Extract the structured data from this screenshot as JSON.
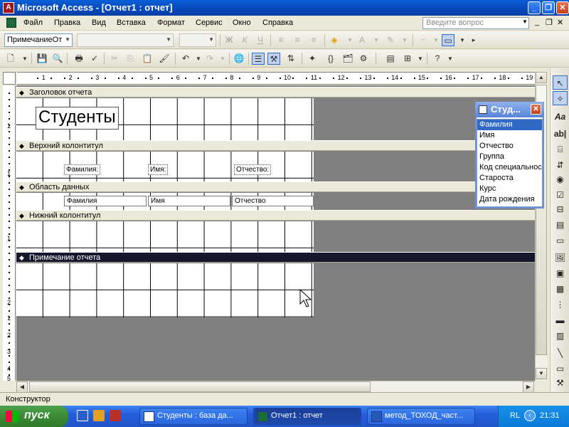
{
  "window": {
    "title": "Microsoft Access - [Отчет1 : отчет]",
    "app_icon": "access-icon",
    "controls": [
      "minimize-icon",
      "maximize-icon",
      "close-icon"
    ]
  },
  "menu": {
    "items": [
      "Файл",
      "Правка",
      "Вид",
      "Вставка",
      "Формат",
      "Сервис",
      "Окно",
      "Справка"
    ],
    "help_placeholder": "Введите вопрос"
  },
  "format_toolbar": {
    "object_select": "ПримечаниеОт",
    "font_select": "",
    "size_select": "",
    "icons": [
      "bold-icon",
      "italic-icon",
      "underline-icon",
      "align-left-icon",
      "align-center-icon",
      "align-right-icon",
      "fill-color-icon",
      "font-color-icon",
      "line-color-icon",
      "line-width-icon",
      "special-effect-icon"
    ]
  },
  "design_toolbar": {
    "icons": [
      "view-icon",
      "save-icon",
      "print-preview-icon",
      "print-icon",
      "cut-icon",
      "copy-icon",
      "paste-icon",
      "undo-icon",
      "redo-icon",
      "hyperlink-icon",
      "field-list-icon",
      "toolbox-icon",
      "sorting-grouping-icon",
      "autoformat-icon",
      "properties-icon",
      "build-icon",
      "database-window-icon",
      "new-object-icon",
      "help-icon"
    ]
  },
  "ruler": {
    "labels": [
      "1",
      "2",
      "3",
      "4",
      "5",
      "6",
      "7",
      "8",
      "9",
      "10",
      "11",
      "12",
      "13",
      "14",
      "15",
      "16",
      "17",
      "18",
      "19"
    ],
    "vertical_labels": [
      "1",
      "1",
      "1",
      "2",
      "1",
      "2",
      "3",
      "4",
      "5"
    ]
  },
  "sections": {
    "report_header": "Заголовок отчета",
    "page_header": "Верхний колонтитул",
    "detail": "Область данных",
    "page_footer": "Нижний колонтитул",
    "report_footer": "Примечание отчета"
  },
  "controls": {
    "title": "Студенты",
    "label_surname": "Фамилия:",
    "label_name": "Имя:",
    "label_patronymic": "Отчество:",
    "field_surname": "Фамилия",
    "field_name": "Имя",
    "field_patronymic": "Отчество"
  },
  "field_list": {
    "title": "Студ...",
    "fields": [
      "Фамилия",
      "Имя",
      "Отчество",
      "Группа",
      "Код специальнос",
      "Староста",
      "Курс",
      "Дата рождения"
    ],
    "selected_index": 0
  },
  "toolbox": {
    "tools": [
      "select-objects-icon",
      "control-wizards-icon",
      "label-icon",
      "textbox-icon",
      "option-group-icon",
      "toggle-button-icon",
      "option-button-icon",
      "checkbox-icon",
      "combobox-icon",
      "listbox-icon",
      "command-button-icon",
      "image-icon",
      "unbound-object-icon",
      "bound-object-icon",
      "page-break-icon",
      "tab-control-icon",
      "subform-icon",
      "line-icon",
      "rectangle-icon",
      "more-controls-icon"
    ]
  },
  "status": {
    "text": "Конструктор"
  },
  "taskbar": {
    "start": "пуск",
    "tasks": [
      "Студенты : база да...",
      "Отчет1 : отчет",
      "метод_ТОХОД_част..."
    ],
    "language": "RL",
    "clock": "21:31"
  }
}
